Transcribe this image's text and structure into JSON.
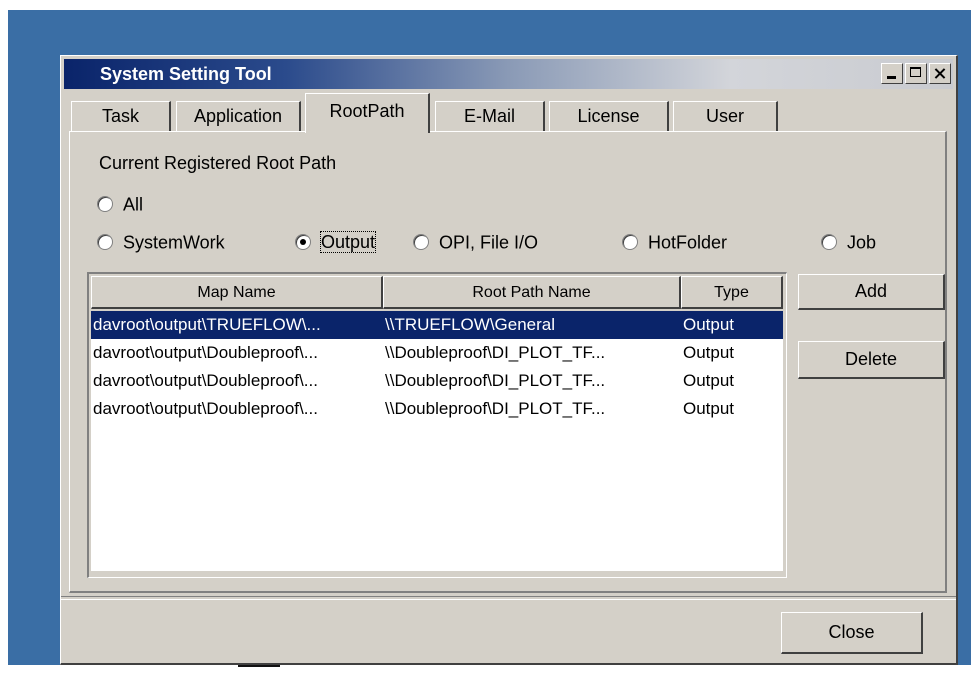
{
  "window": {
    "title": "System Setting Tool"
  },
  "tabs": [
    {
      "label": "Task",
      "active": false
    },
    {
      "label": "Application",
      "active": false
    },
    {
      "label": "RootPath",
      "active": true
    },
    {
      "label": "E-Mail",
      "active": false
    },
    {
      "label": "License",
      "active": false
    },
    {
      "label": "User",
      "active": false
    }
  ],
  "rootpath": {
    "section_label": "Current Registered Root Path",
    "filters": [
      {
        "label": "All",
        "selected": false
      },
      {
        "label": "SystemWork",
        "selected": false
      },
      {
        "label": "Output",
        "selected": true
      },
      {
        "label": "OPI, File I/O",
        "selected": false
      },
      {
        "label": "HotFolder",
        "selected": false
      },
      {
        "label": "Job",
        "selected": false
      }
    ],
    "table": {
      "columns": [
        "Map Name",
        "Root Path Name",
        "Type"
      ],
      "rows": [
        [
          "davroot\\output\\TRUEFLOW\\...",
          "\\\\TRUEFLOW\\General",
          "Output"
        ],
        [
          "davroot\\output\\Doubleproof\\...",
          "\\\\Doubleproof\\DI_PLOT_TF...",
          "Output"
        ],
        [
          "davroot\\output\\Doubleproof\\...",
          "\\\\Doubleproof\\DI_PLOT_TF...",
          "Output"
        ],
        [
          "davroot\\output\\Doubleproof\\...",
          "\\\\Doubleproof\\DI_PLOT_TF...",
          "Output"
        ]
      ],
      "selected_row": 0
    },
    "add_label": "Add",
    "delete_label": "Delete"
  },
  "footer": {
    "close_label": "Close"
  }
}
